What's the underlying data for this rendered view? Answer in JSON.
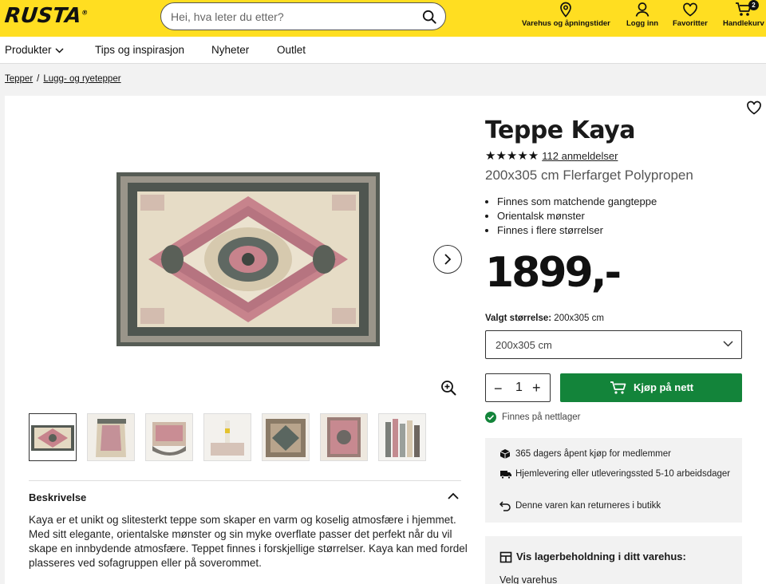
{
  "header": {
    "logo": "RUSTA",
    "search_placeholder": "Hei, hva leter du etter?",
    "items": [
      {
        "label": "Varehus og åpningstider",
        "icon": "location-pin-icon"
      },
      {
        "label": "Logg inn",
        "icon": "user-icon"
      },
      {
        "label": "Favoritter",
        "icon": "heart-icon"
      },
      {
        "label": "Handlekurv",
        "icon": "cart-icon"
      }
    ],
    "cart_count": "2"
  },
  "nav": {
    "items": [
      "Produkter",
      "Tips og inspirasjon",
      "Nyheter",
      "Outlet"
    ]
  },
  "breadcrumb": [
    "Tepper",
    "Lugg- og ryetepper"
  ],
  "product": {
    "title": "Teppe Kaya",
    "stars": "★★★★★",
    "rating": 5,
    "reviews": "112 anmeldelser",
    "subtitle": "200x305 cm Flerfarget Polypropen",
    "bullets": [
      "Finnes som matchende gangteppe",
      "Orientalsk mønster",
      "Finnes i flere størrelser"
    ],
    "price": "1899,-",
    "size_label": "Valgt størrelse:",
    "size_value": "200x305 cm",
    "size_select": "200x305 cm",
    "quantity": "1",
    "buy_label": "Kjøp på nett",
    "stock": "Finnes på nettlager",
    "benefits": [
      "365 dagers åpent kjøp for medlemmer",
      "Hjemlevering eller utleveringssted 5-10 arbeidsdager",
      "Denne varen kan returneres i butikk"
    ],
    "store_stock_title": "Vis lagerbeholdning i ditt varehus:",
    "store_stock_sub": "Velg varehus"
  },
  "description": {
    "title": "Beskrivelse",
    "text": "Kaya er et unikt og slitesterkt teppe som skaper en varm og koselig atmosfære i hjemmet. Med sitt elegante, orientalske mønster og sin myke overflate passer det perfekt når du vil skape en innbydende atmosfære. Teppet finnes i forskjellige størrelser. Kaya kan med fordel plasseres ved sofagruppen eller på soverommet."
  },
  "colors": {
    "brand_yellow": "#ffde21",
    "buy_green": "#13843a",
    "rug_pink": "#c7838c",
    "rug_cream": "#e9e0cc",
    "rug_dark": "#5a6058"
  }
}
